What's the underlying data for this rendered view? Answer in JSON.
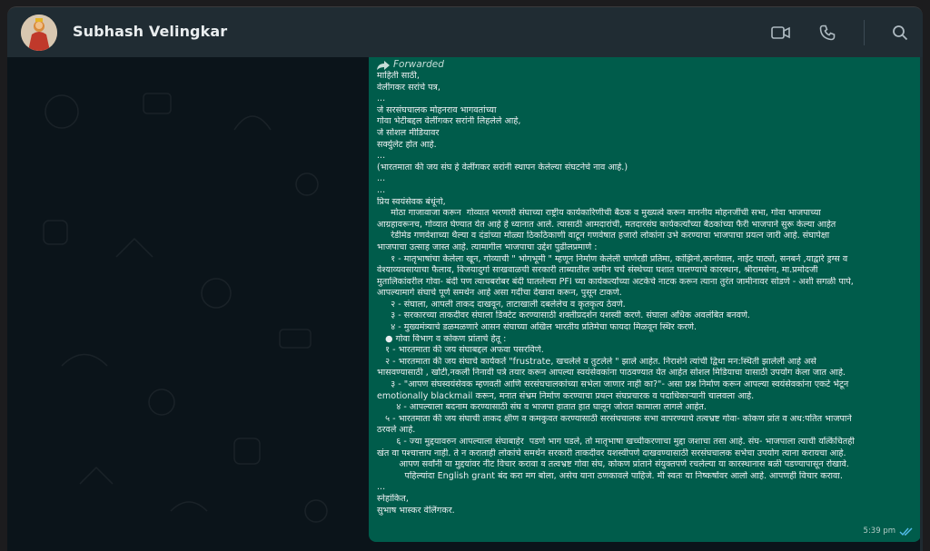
{
  "header": {
    "contact_name": "Subhash Velingkar",
    "icons": [
      "video-call-icon",
      "voice-call-icon",
      "search-icon"
    ]
  },
  "message": {
    "forwarded_label": "Forwarded",
    "time": "5:39 pm",
    "status": "read",
    "lines": [
      "माहिती साठी,",
      "वेलींगकर सरांचे पत्र,",
      "...",
      "जे सरसंघचालक मोहनराव भागवतांच्या",
      "गोवा भेटीबद्दल वेलींगकर सरांनी लिहलेले आहे,",
      "जे सोशल मीडियावर",
      "सर्क्युलेट होत आहे.",
      "...",
      "(भारतमाता की जय संघ हे वेलींगकर सरांनी स्थापन केलेल्या संघटनेचे नाव आहे.)",
      "...",
      "...",
      "प्रिय स्वयंसेवक बंधूंनो,",
      "     मोठा गाजावाजा करून  गोव्यात भरणारी संघाच्या राष्ट्रीय कार्यकारिणीची बैठक व मुख्यत्वे करून माननीय मोहनजींची सभा, गोवा भाजपाच्या",
      "आग्रहावरूनच, गोव्यात घेण्यात येत आहे हे ध्यानात आले. त्यासाठी आमदारांची, मतदारसंघ कार्यकर्त्यांच्या बैठकांच्या फैरी भाजपाने सुरू केल्या आहेत",
      "     रेडीमेड गणवेशाच्या थैल्या व दंडांच्या मोळ्या ठिकठिकाणी वाटून गणवेषात हजारो लोकांना उभे करण्याचा भाजपाचा प्रयत्न जारी आहे. संघापेक्षा",
      "भाजपाचा उत्साह जास्त आहे. त्यामागील भाजपाचा उद्देश पुढीलप्रमाणे :",
      "     १ - मातृभाषांचा केलेला खून, गोव्याची \" भोगभूमी \" म्हणून निर्माण केलेली घाणेरडी प्रतिमा, कांझिनो,कार्नावाल, नाईट पार्ट्या, सनबर्न ,याद्वारे ड्रग्स व",
      "वेश्याव्यवसायाचा फैलाव, विजयादुर्गा साखवाळची सरकारी ताब्यातील जमीन चर्च संस्थेच्या घशात घालण्याचे कारस्थान, श्रीरामसेना, मा.प्रमोदजी",
      "मुतालिकांवरील गोवा- बंदी पण त्याचबरोबर बंदी घातलेल्या PFI च्या कार्यकर्त्यांच्या अटकेचे नाटक करून त्याना तुरंत जामीनावर सोडणे - अशी सगळी पापे,",
      "आपल्यामागे संघाचे पूर्ण समर्थन आहे असा गर्दीचा देखावा करून, पुसून टाकणे.",
      "     २ - संघाला, आपली ताकद दाखवून, ताटाखाली दबलेलेच व कृतकृत्य ठेवणे.",
      "     ३ - सरकारच्या ताकदीवर संघाला डिक्टेट करण्यासाठी शक्तीप्रदर्शन यशस्वी करणे. संघाला अधिक अवलंबित बनवणे.",
      "     ४ - मुख्यमंत्र्याचे डळमळणारे आसन संघाच्या अखिल भारतीय प्रतिमेचा फायदा मिळवून स्थिर करणे.",
      "   ● गोवा विभाग व कोकण प्रांताचे हेतू :",
      "   १ - भारतमाता की जय संघाबद्दल अफवा पसरविणे.",
      "   २ - भारतमाता की जय संघाचे कार्यकर्ते \"frustrate, खचलेले व तुटलेले \" झाले आहेत. निराशेने त्यांची द्विधा मन:स्थिती झालेली आहे असे",
      "भासवण्यासाठी , खोटी,नकली निनावी पत्रे तयार करून आपल्या स्वयंसेवकांना पाठवण्यात येत आहेत सोशल मिडियाचा यासाठी उपयोग केला जात आहे.",
      "     ३ - \"आपण संघस्वयंसेवक म्हणवती आणि सरसंघचालकांच्या सभेला जाणार नाही का?\"- असा प्रश्न निर्माण करून आपल्या स्वयंसेवकांना एकटे भेटून",
      "emotionally blackmail करून, मनात संभ्रम निर्माण करण्याचा प्रयत्न संघप्रचारक व पदाधिकाऱ्यानी चालवला आहे.",
      "       ४ - आपल्याला बदनाम करण्यासाठी संघ व भाजपा हातात हात घालून जोरात कामाला लागले आहेत.",
      "   ५ - भारतमाता की जय संघाची ताकद क्षीण व कमकुवत करण्यासाठी सरसंघचालक सभा वापरण्याचे तत्वभ्रष्ट गोवा- कोकण प्रांत व अध:पतित भाजपाने",
      "ठरवले आहे.",
      "       ६ - ज्या मुद्दयावरुन आपल्याला संघाबाहेर  पडणे भाग पडले, तो मातृभाषा खच्चीकरणाचा मुद्दा जशाचा तसा आहे. संघ- भाजपाला त्याची यत्किंचितही",
      "खंत वा पश्चात्ताप नाही. ते न कराताही लोकांचे समर्थन सरकारी ताकदीवर यशस्वीपणे दाखवण्यासाठी सरसंघचालक सभेचा उपयोग त्याना करायचा आहे.",
      "        आपण सर्वांनी या मुद्दयांवर नीट विचार करावा व तत्वभ्रष्ट गोवा संघ, कोकण प्रांताने संयुक्तपणे रचलेल्या या कारस्थानास बळी पडण्यापासून रोखावे.",
      "          पहिल्यांदा English grant बंद करा मग बोला, असेच याना ठणकावले पाहिजे. मी स्वतः या निष्कर्षावर आलो आहे. आपणही विचार करावा.",
      "...",
      "स्नेहांकित,",
      "सुभाष भास्कर वेलिंगकर."
    ]
  }
}
